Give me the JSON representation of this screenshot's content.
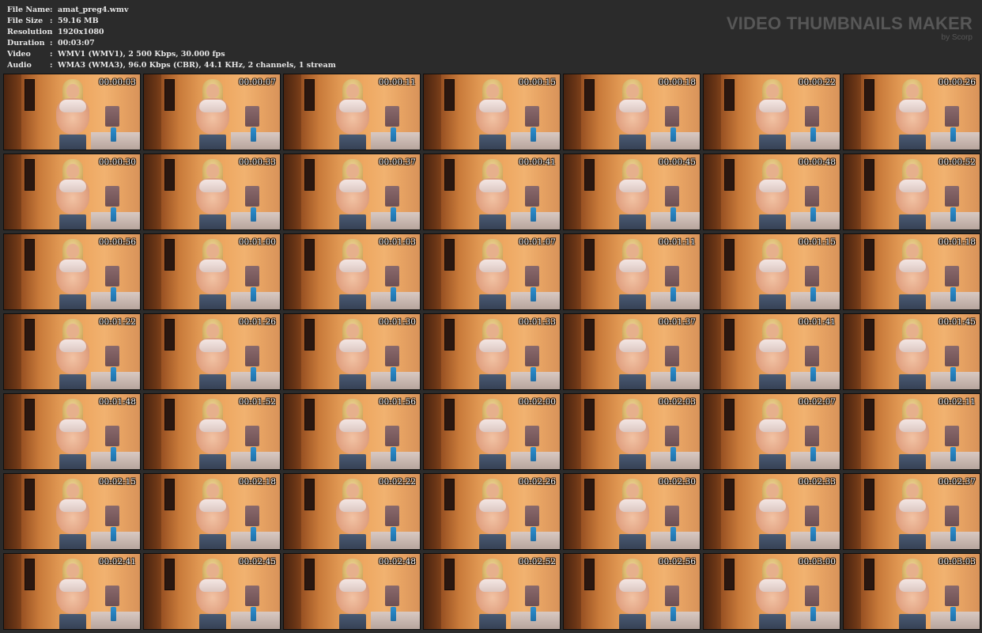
{
  "info": [
    {
      "label": "File Name",
      "value": "amat_preg4.wmv"
    },
    {
      "label": "File Size",
      "value": "59.16 MB"
    },
    {
      "label": "Resolution",
      "value": "1920x1080"
    },
    {
      "label": "Duration",
      "value": "00:03:07"
    },
    {
      "label": "Video",
      "value": "WMV1 (WMV1), 2 500 Kbps, 30.000 fps"
    },
    {
      "label": "Audio",
      "value": "WMA3 (WMA3), 96.0 Kbps (CBR), 44.1 KHz, 2 channels, 1 stream"
    }
  ],
  "separator": ":",
  "brand": {
    "title": "VIDEO THUMBNAILS MAKER",
    "subtitle": "by Scorp"
  },
  "thumbnails": [
    "00:00:03",
    "00:00:07",
    "00:00:11",
    "00:00:15",
    "00:00:18",
    "00:00:22",
    "00:00:26",
    "00:00:30",
    "00:00:33",
    "00:00:37",
    "00:00:41",
    "00:00:45",
    "00:00:48",
    "00:00:52",
    "00:00:56",
    "00:01:00",
    "00:01:03",
    "00:01:07",
    "00:01:11",
    "00:01:15",
    "00:01:18",
    "00:01:22",
    "00:01:26",
    "00:01:30",
    "00:01:33",
    "00:01:37",
    "00:01:41",
    "00:01:45",
    "00:01:48",
    "00:01:52",
    "00:01:56",
    "00:02:00",
    "00:02:03",
    "00:02:07",
    "00:02:11",
    "00:02:15",
    "00:02:18",
    "00:02:22",
    "00:02:26",
    "00:02:30",
    "00:02:33",
    "00:02:37",
    "00:02:41",
    "00:02:45",
    "00:02:48",
    "00:02:52",
    "00:02:56",
    "00:03:00",
    "00:03:03"
  ]
}
